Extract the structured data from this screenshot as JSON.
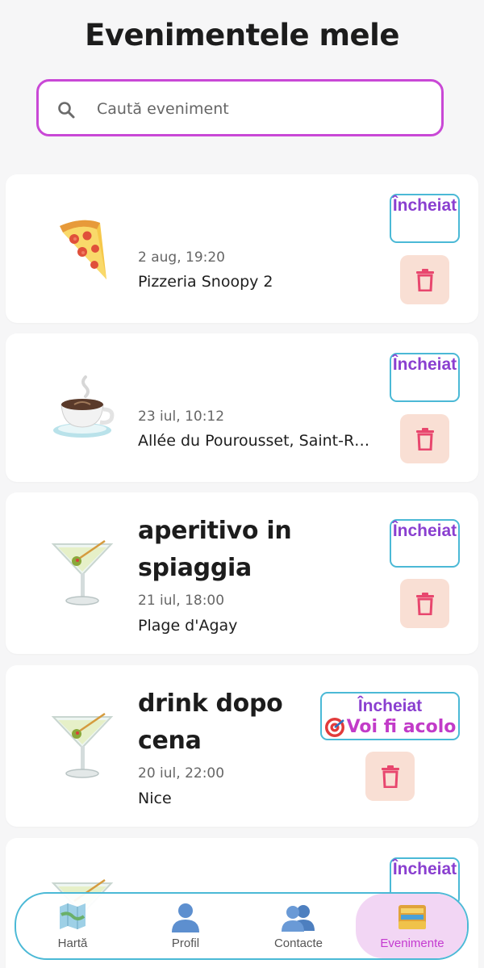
{
  "page": {
    "title": "Evenimentele mele"
  },
  "search": {
    "placeholder": "Caută eveniment"
  },
  "events": [
    {
      "name": "",
      "date": "2 aug, 19:20",
      "location": "Pizzeria Snoopy 2",
      "status": "Încheiat",
      "icon": "pizza-icon"
    },
    {
      "name": "",
      "date": "23 iul, 10:12",
      "location": "Allée du Pourousset, Saint-R…",
      "status": "Încheiat",
      "icon": "coffee-icon"
    },
    {
      "name": "aperitivo in spiaggia",
      "date": "21 iul, 18:00",
      "location": "Plage d'Agay",
      "status": "Încheiat",
      "icon": "cocktail-icon"
    },
    {
      "name": "drink dopo cena",
      "date": "20 iul, 22:00",
      "location": "Nice",
      "status": "Încheiat",
      "attendance": "Voi fi acolo",
      "icon": "cocktail-icon"
    },
    {
      "status": "Încheiat",
      "icon": "cocktail-icon"
    }
  ],
  "nav": {
    "items": [
      {
        "label": "Hartă",
        "icon": "map-icon"
      },
      {
        "label": "Profil",
        "icon": "user-icon"
      },
      {
        "label": "Contacte",
        "icon": "contacts-icon"
      },
      {
        "label": "Evenimente",
        "icon": "folder-icon"
      }
    ],
    "active": "Evenimente"
  },
  "colors": {
    "accent": "#c948d6",
    "status_border": "#4bb9d6",
    "status_text": "#8a3fd0",
    "delete_bg": "#f9dfd4",
    "delete_icon": "#e8476e"
  }
}
